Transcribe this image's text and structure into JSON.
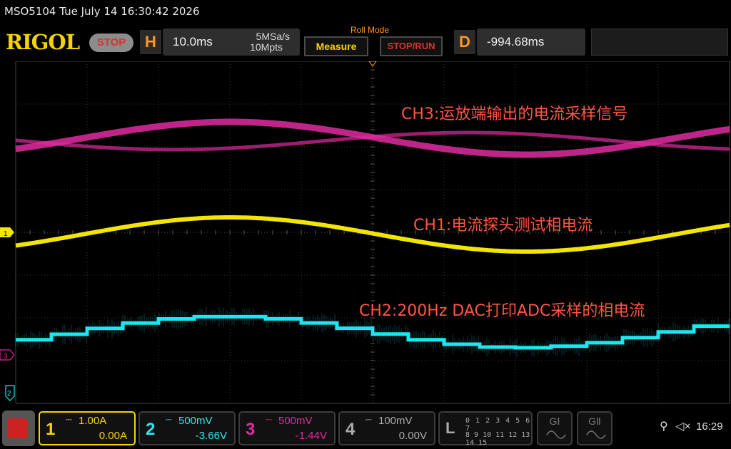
{
  "status": {
    "model_datetime": "MSO5104  Tue July 14 16:30:42 2026"
  },
  "header": {
    "brand": "RIGOL",
    "run_state": "STOP",
    "horizontal": {
      "letter": "H",
      "timebase": "10.0ms",
      "sample_rate": "5MSa/s",
      "memory_depth": "10Mpts"
    },
    "acq_mode": "Roll Mode",
    "measure_label": "Measure",
    "stop_run_label": "STOP/RUN",
    "delay": {
      "letter": "D",
      "value": "-994.68ms"
    }
  },
  "traces": [
    {
      "channel": "CH3",
      "color": "#e02ba0",
      "label": "CH3:运放端输出的电流采样信号"
    },
    {
      "channel": "CH1",
      "color": "#f2e600",
      "label": "CH1:电流探头测试相电流"
    },
    {
      "channel": "CH2",
      "color": "#1ee6ee",
      "label": "CH2:200Hz DAC打印ADC采样的相电流"
    }
  ],
  "markers": {
    "ch1": "1",
    "ch3": "3",
    "ch2": "2"
  },
  "channels": [
    {
      "number": "1",
      "scale": "1.00A",
      "offset": "0.00A",
      "color": "#f5d300"
    },
    {
      "number": "2",
      "scale": "500mV",
      "offset": "-3.66V",
      "color": "#2ee6ee"
    },
    {
      "number": "3",
      "scale": "500mV",
      "offset": "-1.44V",
      "color": "#e02ba0"
    },
    {
      "number": "4",
      "scale": "100mV",
      "offset": "0.00V",
      "color": "#aaaaaa"
    }
  ],
  "logic": {
    "letter": "L",
    "row1": "0 1 2 3  4 5 6 7",
    "row2": "8 9 10 11  12 13 14 15"
  },
  "generators": [
    {
      "label": "GⅠ"
    },
    {
      "label": "GⅡ"
    }
  ],
  "system": {
    "usb_icon": "usb-icon",
    "mute_icon": "speaker-mute-icon",
    "clock": "16:29"
  },
  "colors": {
    "ch1": "#f2e600",
    "ch2": "#1ee6ee",
    "ch3": "#e02ba0",
    "accent": "#ff9a1f",
    "label_red": "#ff5544"
  }
}
